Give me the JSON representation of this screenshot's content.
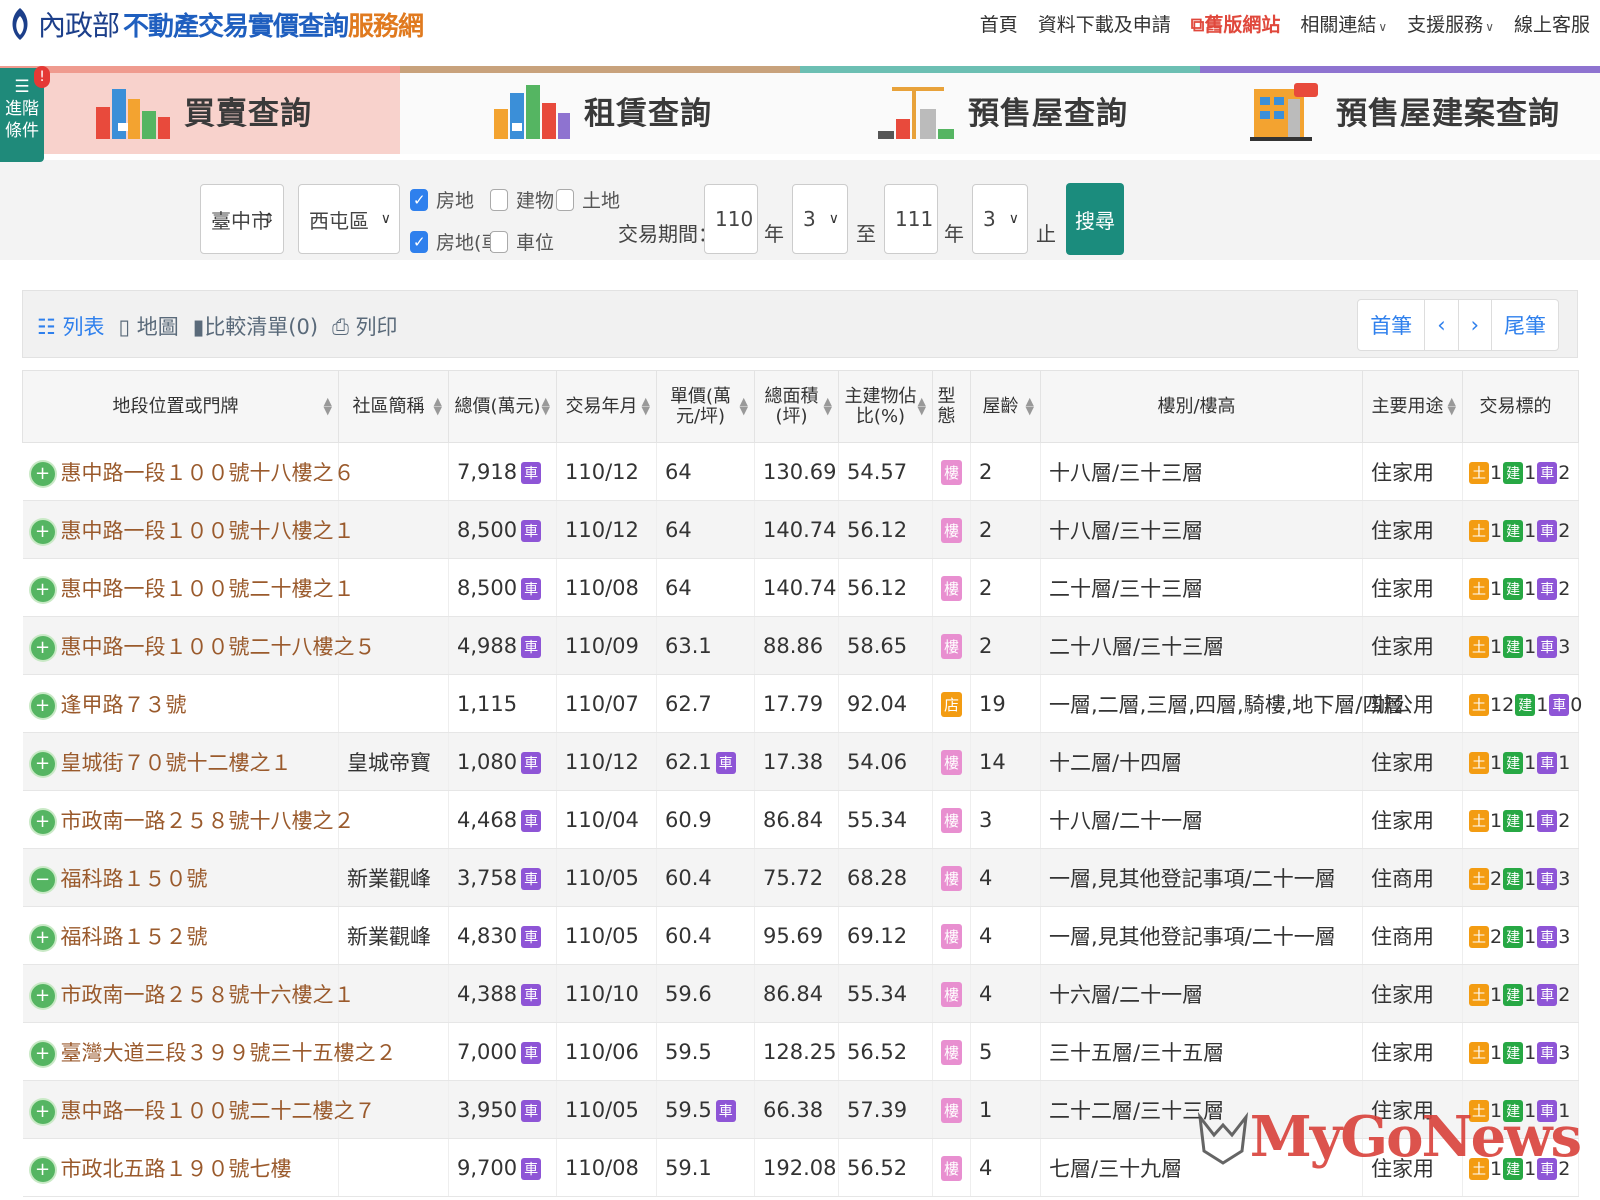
{
  "header": {
    "logo_ministry": "內政部",
    "logo_main": "不動產交易實價查詢",
    "logo_suffix": "服務網",
    "nav": [
      "首頁",
      "資料下載及申請",
      "舊版網站",
      "相關連結",
      "支援服務",
      "線上客服"
    ]
  },
  "advanced": {
    "label_line1": "進階",
    "label_line2": "條件",
    "badge": "!"
  },
  "tabs": [
    {
      "label": "買賣查詢",
      "icon": "buildings-sale-icon"
    },
    {
      "label": "租賃查詢",
      "icon": "buildings-rent-icon"
    },
    {
      "label": "預售屋查詢",
      "icon": "construction-crane-icon"
    },
    {
      "label": "預售屋建案查詢",
      "icon": "new-building-icon"
    }
  ],
  "filter": {
    "city": "臺中市",
    "district": "西屯區",
    "types": [
      {
        "label": "房地",
        "checked": true
      },
      {
        "label": "建物",
        "checked": false
      },
      {
        "label": "土地",
        "checked": false
      },
      {
        "label": "房地(車)",
        "checked": true
      },
      {
        "label": "車位",
        "checked": false
      }
    ],
    "period_label": "交易期間：",
    "from_year": "110",
    "year_unit": "年",
    "from_month": "3",
    "to_label": "至",
    "to_year": "111",
    "to_month": "3",
    "end_label": "止",
    "search": "搜尋"
  },
  "toolbar": {
    "list": "列表",
    "map": "地圖",
    "compare": "比較清單(0)",
    "print": "列印",
    "first": "首筆",
    "prev": "‹",
    "next": "›",
    "last": "尾筆"
  },
  "table": {
    "headers": [
      "地段位置或門牌",
      "社區簡稱",
      "總價(萬元)",
      "交易年月",
      "單價(萬元/坪)",
      "總面積(坪)",
      "主建物佔比(%)",
      "型態",
      "屋齡",
      "樓別/樓高",
      "主要用途",
      "交易標的"
    ],
    "rows": [
      {
        "addr": "惠中路一段１００號十八樓之６",
        "community": "",
        "total": "7,918",
        "total_car": true,
        "date": "110/12",
        "unit": "64",
        "unit_car": false,
        "area": "130.69",
        "ratio": "54.57",
        "type": "樓",
        "age": "2",
        "floor": "十八層/三十三層",
        "use": "住家用",
        "t": "1",
        "j": "1",
        "c": "2",
        "sign": "+"
      },
      {
        "addr": "惠中路一段１００號十八樓之１",
        "community": "",
        "total": "8,500",
        "total_car": true,
        "date": "110/12",
        "unit": "64",
        "unit_car": false,
        "area": "140.74",
        "ratio": "56.12",
        "type": "樓",
        "age": "2",
        "floor": "十八層/三十三層",
        "use": "住家用",
        "t": "1",
        "j": "1",
        "c": "2",
        "sign": "+"
      },
      {
        "addr": "惠中路一段１００號二十樓之１",
        "community": "",
        "total": "8,500",
        "total_car": true,
        "date": "110/08",
        "unit": "64",
        "unit_car": false,
        "area": "140.74",
        "ratio": "56.12",
        "type": "樓",
        "age": "2",
        "floor": "二十層/三十三層",
        "use": "住家用",
        "t": "1",
        "j": "1",
        "c": "2",
        "sign": "+"
      },
      {
        "addr": "惠中路一段１００號二十八樓之５",
        "community": "",
        "total": "4,988",
        "total_car": true,
        "date": "110/09",
        "unit": "63.1",
        "unit_car": false,
        "area": "88.86",
        "ratio": "58.65",
        "type": "樓",
        "age": "2",
        "floor": "二十八層/三十三層",
        "use": "住家用",
        "t": "1",
        "j": "1",
        "c": "3",
        "sign": "+"
      },
      {
        "addr": "逢甲路７３號",
        "community": "",
        "total": "1,115",
        "total_car": false,
        "date": "110/07",
        "unit": "62.7",
        "unit_car": false,
        "area": "17.79",
        "ratio": "92.04",
        "type": "店",
        "age": "19",
        "floor": "一層,二層,三層,四層,騎樓,地下層/四層",
        "use": "辦公用",
        "t": "12",
        "j": "1",
        "c": "0",
        "sign": "+"
      },
      {
        "addr": "皇城街７０號十二樓之１",
        "community": "皇城帝寶",
        "total": "1,080",
        "total_car": true,
        "date": "110/12",
        "unit": "62.1",
        "unit_car": true,
        "area": "17.38",
        "ratio": "54.06",
        "type": "樓",
        "age": "14",
        "floor": "十二層/十四層",
        "use": "住家用",
        "t": "1",
        "j": "1",
        "c": "1",
        "sign": "+"
      },
      {
        "addr": "市政南一路２５８號十八樓之２",
        "community": "",
        "total": "4,468",
        "total_car": true,
        "date": "110/04",
        "unit": "60.9",
        "unit_car": false,
        "area": "86.84",
        "ratio": "55.34",
        "type": "樓",
        "age": "3",
        "floor": "十八層/二十一層",
        "use": "住家用",
        "t": "1",
        "j": "1",
        "c": "2",
        "sign": "+"
      },
      {
        "addr": "福科路１５０號",
        "community": "新業觀峰",
        "total": "3,758",
        "total_car": true,
        "date": "110/05",
        "unit": "60.4",
        "unit_car": false,
        "area": "75.72",
        "ratio": "68.28",
        "type": "樓",
        "age": "4",
        "floor": "一層,見其他登記事項/二十一層",
        "use": "住商用",
        "t": "2",
        "j": "1",
        "c": "3",
        "sign": "−"
      },
      {
        "addr": "福科路１５２號",
        "community": "新業觀峰",
        "total": "4,830",
        "total_car": true,
        "date": "110/05",
        "unit": "60.4",
        "unit_car": false,
        "area": "95.69",
        "ratio": "69.12",
        "type": "樓",
        "age": "4",
        "floor": "一層,見其他登記事項/二十一層",
        "use": "住商用",
        "t": "2",
        "j": "1",
        "c": "3",
        "sign": "+"
      },
      {
        "addr": "市政南一路２５８號十六樓之１",
        "community": "",
        "total": "4,388",
        "total_car": true,
        "date": "110/10",
        "unit": "59.6",
        "unit_car": false,
        "area": "86.84",
        "ratio": "55.34",
        "type": "樓",
        "age": "4",
        "floor": "十六層/二十一層",
        "use": "住家用",
        "t": "1",
        "j": "1",
        "c": "2",
        "sign": "+"
      },
      {
        "addr": "臺灣大道三段３９９號三十五樓之２",
        "community": "",
        "total": "7,000",
        "total_car": true,
        "date": "110/06",
        "unit": "59.5",
        "unit_car": false,
        "area": "128.25",
        "ratio": "56.52",
        "type": "樓",
        "age": "5",
        "floor": "三十五層/三十五層",
        "use": "住家用",
        "t": "1",
        "j": "1",
        "c": "3",
        "sign": "+"
      },
      {
        "addr": "惠中路一段１００號二十二樓之７",
        "community": "",
        "total": "3,950",
        "total_car": true,
        "date": "110/05",
        "unit": "59.5",
        "unit_car": true,
        "area": "66.38",
        "ratio": "57.39",
        "type": "樓",
        "age": "1",
        "floor": "二十二層/三十三層",
        "use": "住家用",
        "t": "1",
        "j": "1",
        "c": "1",
        "sign": "+"
      },
      {
        "addr": "市政北五路１９０號七樓",
        "community": "",
        "total": "9,700",
        "total_car": true,
        "date": "110/08",
        "unit": "59.1",
        "unit_car": false,
        "area": "192.08",
        "ratio": "56.52",
        "type": "樓",
        "age": "4",
        "floor": "七層/三十九層",
        "use": "住家用",
        "t": "1",
        "j": "1",
        "c": "2",
        "sign": "+"
      }
    ],
    "car_label": "車",
    "tag_land": "土",
    "tag_bld": "建",
    "tag_car": "車"
  },
  "watermark": "MyGoNews",
  "colors": {
    "teal": "#1b8c7d",
    "link_brown": "#9a5a2c",
    "blue": "#2f80ed"
  }
}
